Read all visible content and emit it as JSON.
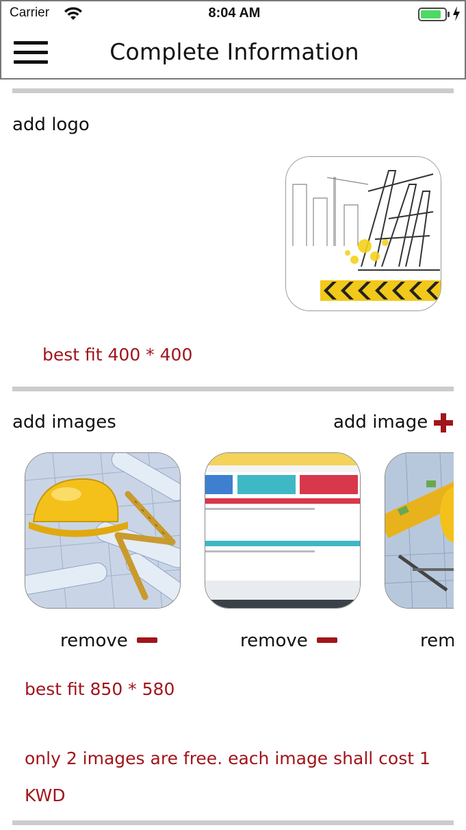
{
  "status_bar": {
    "carrier": "Carrier",
    "time": "8:04 AM",
    "battery_level": 0.85
  },
  "header": {
    "title": "Complete Information",
    "menu_icon": "hamburger-menu-icon"
  },
  "logo_section": {
    "label": "add logo",
    "hint": "best fit 400 * 400"
  },
  "images_section": {
    "label": "add images",
    "add_image_label": "add image",
    "add_icon": "plus-icon",
    "items": [
      {
        "remove_label": "remove",
        "remove_icon": "minus-icon"
      },
      {
        "remove_label": "remove",
        "remove_icon": "minus-icon"
      },
      {
        "remove_label": "remove",
        "remove_icon": "minus-icon"
      }
    ],
    "hint": "best fit 850 * 580",
    "cost_notice": "only 2 images are free. each image shall cost 1 KWD"
  },
  "colors": {
    "accent": "#a0151c",
    "divider": "#cccccc",
    "battery": "#4cd964"
  }
}
